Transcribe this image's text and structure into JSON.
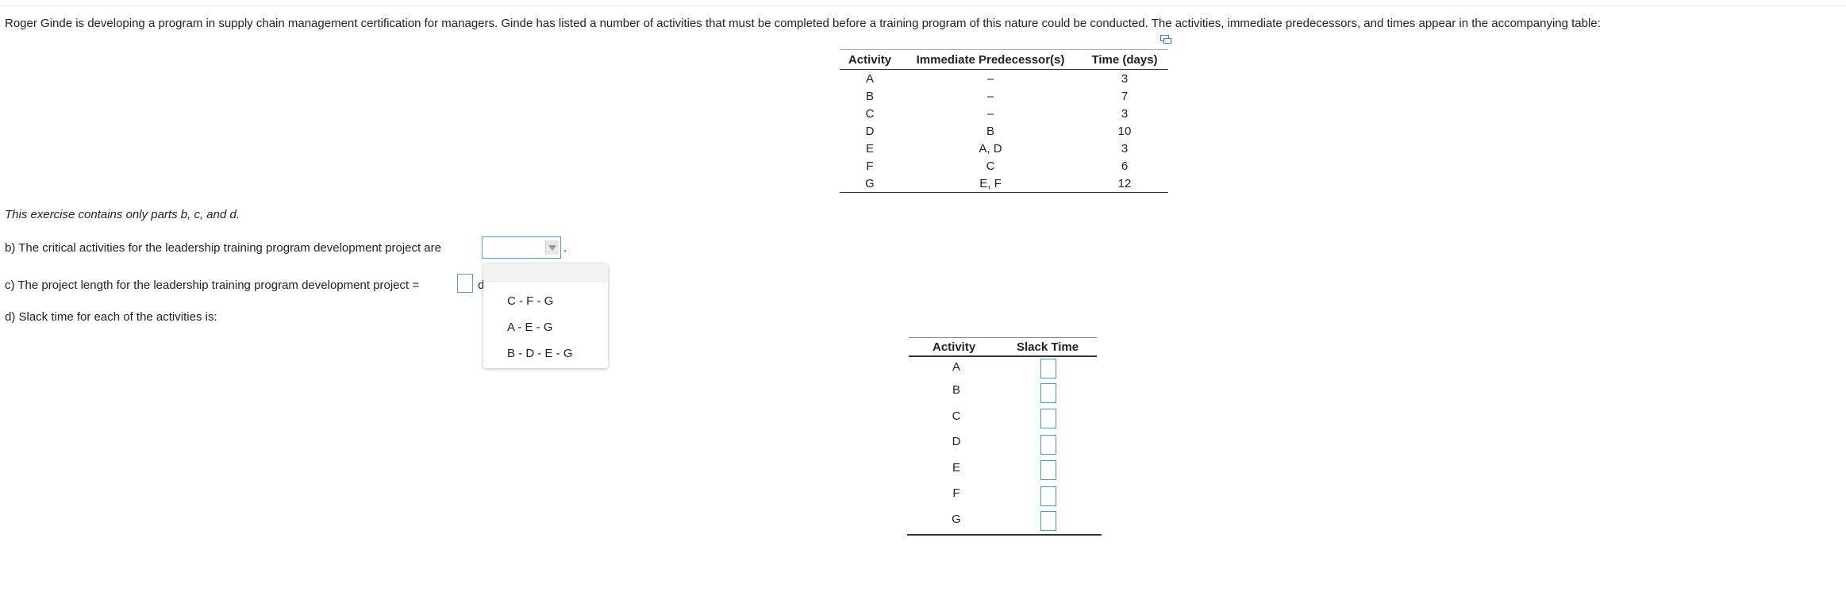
{
  "intro_text": "Roger Ginde is developing a program in supply chain management certification for managers. Ginde has listed a number of activities that must be completed before a training program of this nature could be conducted. The activities, immediate predecessors, and times appear in the accompanying table:",
  "pred_table": {
    "headers": [
      "Activity",
      "Immediate Predecessor(s)",
      "Time (days)"
    ],
    "rows": [
      {
        "activity": "A",
        "pred": "–",
        "time": "3"
      },
      {
        "activity": "B",
        "pred": "–",
        "time": "7"
      },
      {
        "activity": "C",
        "pred": "–",
        "time": "3"
      },
      {
        "activity": "D",
        "pred": "B",
        "time": "10"
      },
      {
        "activity": "E",
        "pred": "A, D",
        "time": "3"
      },
      {
        "activity": "F",
        "pred": "C",
        "time": "6"
      },
      {
        "activity": "G",
        "pred": "E, F",
        "time": "12"
      }
    ]
  },
  "note": "This exercise contains only parts b, c, and d.",
  "question_b": "b) The critical activities for the leadership training program development project are",
  "question_b_end": ".",
  "question_c": "c) The project length for the leadership training program development project =",
  "question_c_cut": "d",
  "question_d": "d) Slack time for each of the activities is:",
  "dropdown": {
    "selected": "",
    "options": [
      "C - F - G",
      "A - E - G",
      "B - D - E - G"
    ]
  },
  "slack_table": {
    "headers": [
      "Activity",
      "Slack Time"
    ],
    "activities": [
      "A",
      "B",
      "C",
      "D",
      "E",
      "F",
      "G"
    ]
  },
  "colors": {
    "input_border": "#5b9bd5",
    "slack_input_border": "#3a9fd0"
  },
  "icons": {
    "expand": "expand-table-icon",
    "dropdown_arrow": "chevron-down-icon"
  }
}
